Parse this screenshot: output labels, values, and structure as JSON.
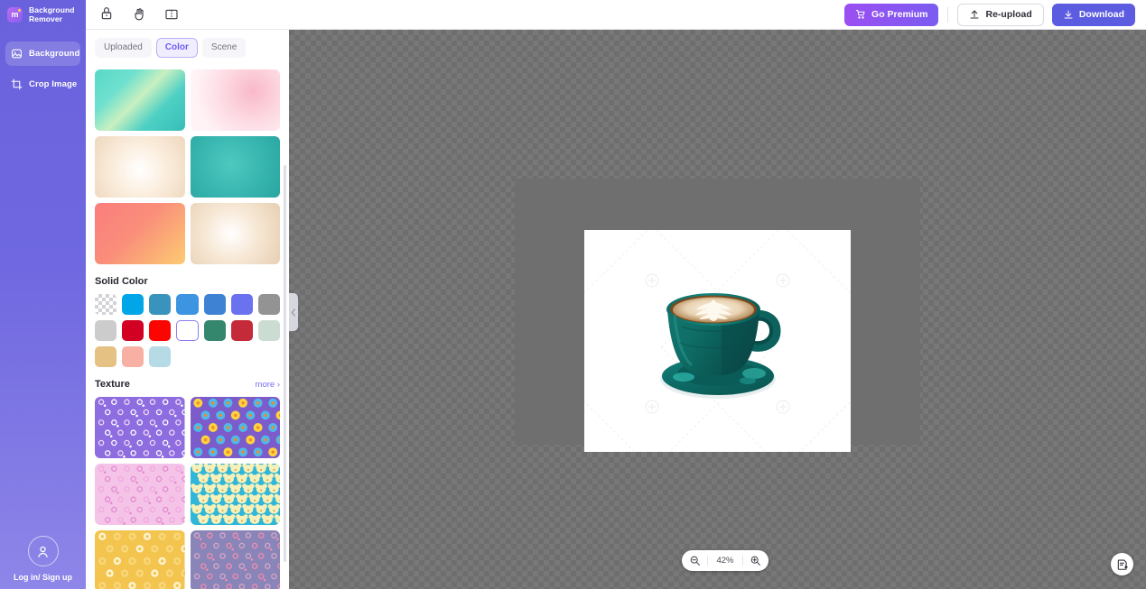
{
  "app": {
    "brand_initials": "m",
    "brand_line1": "Background",
    "brand_line2": "Remover"
  },
  "sidebar": {
    "items": [
      {
        "label": "Background",
        "icon": "image-icon",
        "active": true
      },
      {
        "label": "Crop Image",
        "icon": "crop-icon",
        "active": false
      }
    ],
    "account_label": "Log in/ Sign up",
    "account_icon": "user-icon"
  },
  "toolbar": {
    "tools": [
      {
        "name": "eraser-tool",
        "icon": "eraser-icon"
      },
      {
        "name": "pan-tool",
        "icon": "hand-icon"
      },
      {
        "name": "compare-tool",
        "icon": "split-view-icon"
      }
    ],
    "premium_label": "Go Premium",
    "premium_icon": "cart-icon",
    "reupload_label": "Re-upload",
    "reupload_icon": "upload-icon",
    "download_label": "Download",
    "download_icon": "download-icon"
  },
  "panel": {
    "tabs": [
      {
        "label": "Uploaded",
        "active": false
      },
      {
        "label": "Color",
        "active": true
      },
      {
        "label": "Scene",
        "active": false
      }
    ],
    "backgrounds": [
      {
        "name": "teal-silk",
        "css": "linear-gradient(135deg,#57d8c6 0%,#6fe0cf 28%,#c8f0c0 48%,#4fd0c4 70%,#35bfb8 100%)"
      },
      {
        "name": "pink-marble",
        "css": "radial-gradient(circle at 70% 35%,#f9b9c9 0%,#fdd9e2 40%,#fff3f6 78%)"
      },
      {
        "name": "beige-cloud",
        "css": "radial-gradient(circle at 50% 55%,#ffffff 0%,#fbeede 45%,#eed7bd 100%)"
      },
      {
        "name": "teal-bokeh",
        "css": "radial-gradient(circle at 45% 45%,#4ec9c0 0%,#35b3ad 60%,#2aa5a0 100%)"
      },
      {
        "name": "coral-gradient",
        "css": "linear-gradient(135deg,#fb7d7d 0%,#fa8e7a 45%,#fccb72 100%)"
      },
      {
        "name": "sand-cloud",
        "css": "radial-gradient(circle at 45% 50%,#ffffff 0%,#f7e8d5 45%,#e7cfb2 100%)"
      }
    ],
    "solid_color": {
      "title": "Solid Color",
      "swatches": [
        {
          "name": "transparent",
          "hex": "transparent",
          "checker": true,
          "selected": false
        },
        {
          "name": "bright-blue",
          "hex": "#00a6e8",
          "selected": false
        },
        {
          "name": "steel-blue",
          "hex": "#3a93bc",
          "selected": false
        },
        {
          "name": "azure-blue",
          "hex": "#3d94e0",
          "selected": false
        },
        {
          "name": "cornflower-blue",
          "hex": "#3e82d4",
          "selected": false
        },
        {
          "name": "periwinkle-blue",
          "hex": "#6a72ef",
          "selected": false
        },
        {
          "name": "gray",
          "hex": "#939393",
          "selected": false
        },
        {
          "name": "light-gray",
          "hex": "#cccccc",
          "selected": false
        },
        {
          "name": "crimson",
          "hex": "#d20023",
          "selected": false
        },
        {
          "name": "red",
          "hex": "#fb0500",
          "selected": false
        },
        {
          "name": "white",
          "hex": "#ffffff",
          "selected": true
        },
        {
          "name": "sea-green",
          "hex": "#34866c",
          "selected": false
        },
        {
          "name": "brick-red",
          "hex": "#c42a39",
          "selected": false
        },
        {
          "name": "pale-mint",
          "hex": "#cbddd3",
          "selected": false
        },
        {
          "name": "tan",
          "hex": "#e5c184",
          "selected": false
        },
        {
          "name": "salmon-pink",
          "hex": "#f7b0a3",
          "selected": false
        },
        {
          "name": "powder-blue",
          "hex": "#b6dbe6",
          "selected": false
        }
      ]
    },
    "texture": {
      "title": "Texture",
      "more_label": "more ›",
      "items": [
        {
          "name": "purple-floral",
          "base": "#8d6de0",
          "dot": "#ffffff",
          "accent": "#f2d9f2"
        },
        {
          "name": "rainbow-flowers",
          "base": "#7c5ccb",
          "dot": "#ffd23f",
          "accent": "#4fb9e8"
        },
        {
          "name": "pink-dots",
          "base": "#f5c3e8",
          "dot": "#e38ad0",
          "accent": "#f0a8dd"
        },
        {
          "name": "blue-bears",
          "base": "#2fb6d8",
          "dot": "#f7f0b8",
          "accent": "#ffffff"
        },
        {
          "name": "yellow-dots",
          "base": "#f3c44e",
          "dot": "#fdf3cf",
          "accent": "#f8d77a"
        },
        {
          "name": "purple-flowers",
          "base": "#8a85b8",
          "dot": "#f48cb0",
          "accent": "#d9a8c8"
        }
      ]
    }
  },
  "canvas": {
    "image_alt": "teal-coffee-cup-with-latte-art",
    "watermark_text": "",
    "zoom_level": "42%",
    "zoom_out_icon": "zoom-out-icon",
    "zoom_in_icon": "zoom-in-icon",
    "feedback_icon": "feedback-icon"
  },
  "colors": {
    "brand_purple": "#6a62dd",
    "accent_purple": "#5b5ce0",
    "premium_gradient_start": "#9b4ff2",
    "canvas_gray": "#6e6e6e"
  }
}
